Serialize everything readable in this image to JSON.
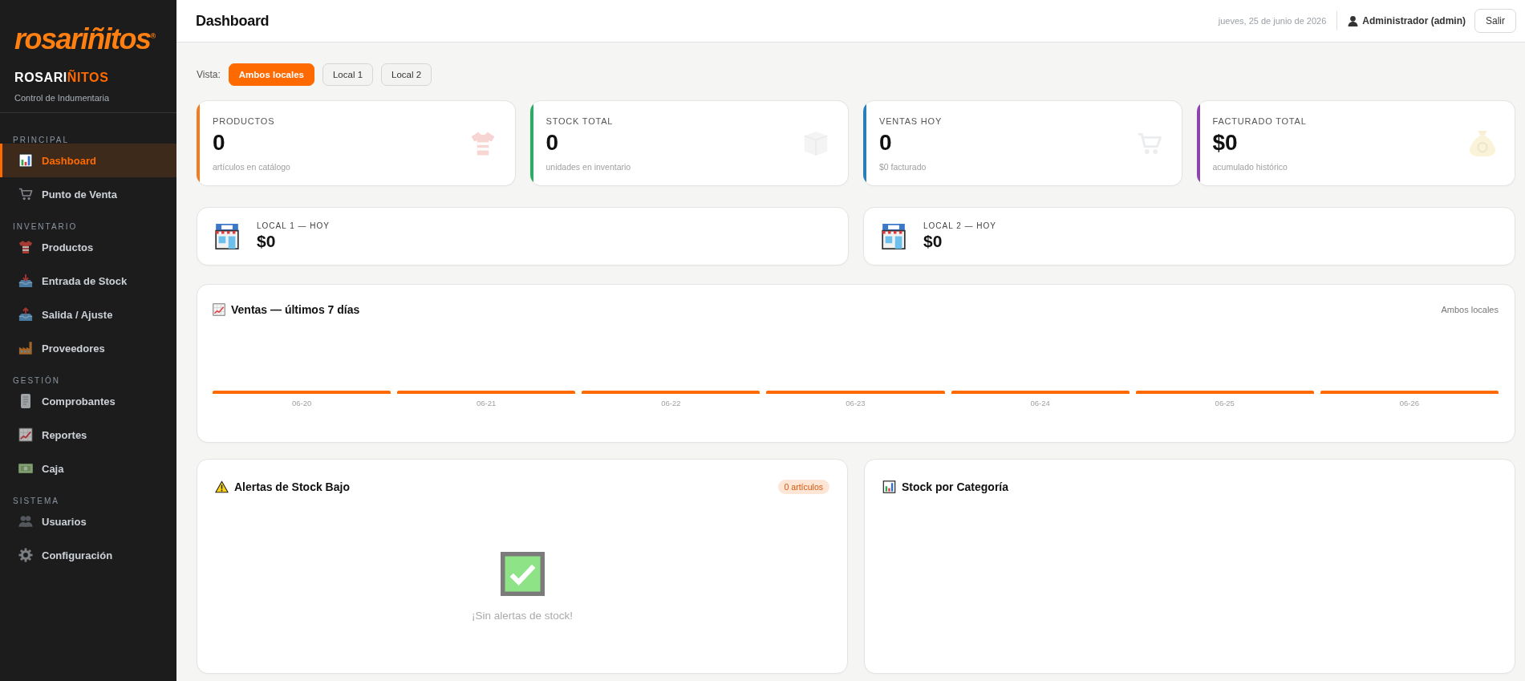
{
  "sidebar": {
    "logo": "rosariñitos$^{®}$",
    "brand": {
      "start": "ROSARI",
      "accent": "ÑITOS"
    },
    "tagline": "Control de Indumentaria",
    "sections": [
      {
        "label": "PRINCIPAL",
        "items": [
          {
            "label": "Dashboard",
            "selected": true
          },
          {
            "label": "Punto de Venta",
            "selected": false
          }
        ]
      },
      {
        "label": "INVENTARIO",
        "items": [
          {
            "label": "Productos",
            "selected": false
          },
          {
            "label": "Entrada de Stock",
            "selected": false
          },
          {
            "label": "Salida / Ajuste",
            "selected": false
          },
          {
            "label": "Proveedores",
            "selected": false
          }
        ]
      },
      {
        "label": "GESTIÓN",
        "items": [
          {
            "label": "Comprobantes",
            "selected": false
          },
          {
            "label": "Reportes",
            "selected": false
          },
          {
            "label": "Caja",
            "selected": false
          }
        ]
      },
      {
        "label": "SISTEMA",
        "items": [
          {
            "label": "Usuarios",
            "selected": false
          },
          {
            "label": "Configuración",
            "selected": false
          }
        ]
      }
    ]
  },
  "header": {
    "title": "Dashboard",
    "date": "jueves, 25 de junio de 2026",
    "user": "Administrador (admin)",
    "logout": "Salir"
  },
  "view_filter": {
    "label": "Vista:",
    "options": [
      {
        "label": "Ambos locales",
        "selected": true
      },
      {
        "label": "Local 1",
        "selected": false
      },
      {
        "label": "Local 2",
        "selected": false
      }
    ]
  },
  "stats": [
    {
      "label": "PRODUCTOS",
      "value": "0",
      "note": "artículos en catálogo",
      "color": "#f47b20"
    },
    {
      "label": "STOCK TOTAL",
      "value": "0",
      "note": "unidades en inventario",
      "color": "#27ae60"
    },
    {
      "label": "VENTAS HOY",
      "value": "0",
      "note": "$0 facturado",
      "color": "#2980b9"
    },
    {
      "label": "FACTURADO TOTAL",
      "value": "$0",
      "note": "acumulado histórico",
      "color": "#8e44ad"
    }
  ],
  "locals": [
    {
      "label": "LOCAL 1 — HOY",
      "value": "$0"
    },
    {
      "label": "LOCAL 2 — HOY",
      "value": "$0"
    }
  ],
  "sales_chart": {
    "title": "Ventas — últimos 7 días",
    "scope": "Ambos locales",
    "days": [
      "06-20",
      "06-21",
      "06-22",
      "06-23",
      "06-24",
      "06-25",
      "06-26"
    ]
  },
  "low_stock": {
    "title": "Alertas de Stock Bajo",
    "badge": "0 artículos",
    "empty_message": "¡Sin alertas de stock!"
  },
  "category_stock": {
    "title": "Stock por Categoría"
  }
}
